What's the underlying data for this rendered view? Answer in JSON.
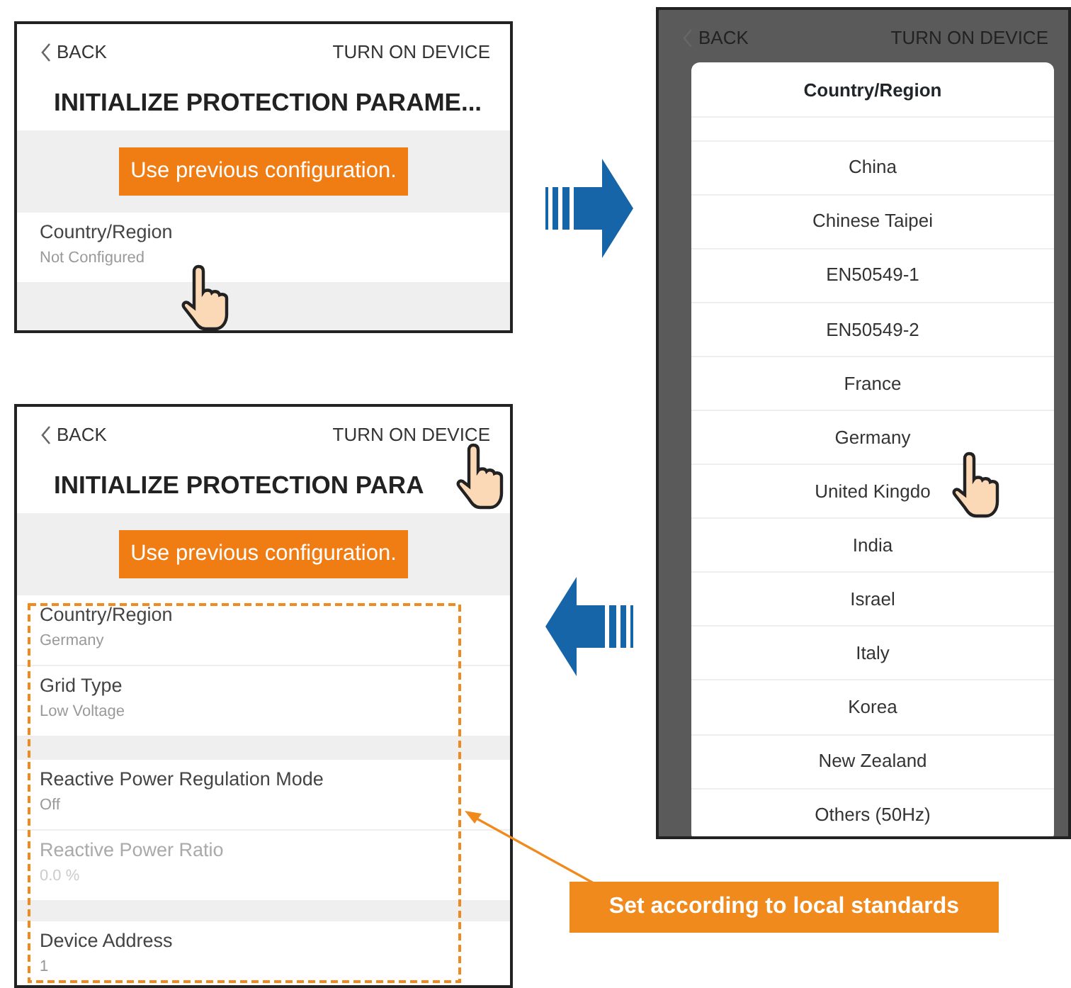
{
  "screens": [
    {
      "kind": "settings",
      "back": "BACK",
      "action": "TURN ON DEVICE",
      "title": "INITIALIZE PROTECTION PARAME...",
      "button": "Use previous configuration.",
      "groups": [
        [
          {
            "label": "Country/Region",
            "value": "Not Configured",
            "disabled": false
          }
        ]
      ]
    },
    {
      "kind": "picker",
      "back": "BACK",
      "action": "TURN ON DEVICE",
      "dialog_title": "Country/Region",
      "options": [
        "China",
        "Chinese Taipei",
        "EN50549-1",
        "EN50549-2",
        "France",
        "Germany",
        "United Kingdo",
        "India",
        "Israel",
        "Italy",
        "Korea",
        "New Zealand",
        "Others (50Hz)"
      ]
    },
    {
      "kind": "settings",
      "back": "BACK",
      "action": "TURN ON DEVICE",
      "title": "INITIALIZE PROTECTION PARA",
      "button": "Use previous configuration.",
      "groups": [
        [
          {
            "label": "Country/Region",
            "value": "Germany",
            "disabled": false
          },
          {
            "label": "Grid Type",
            "value": "Low Voltage",
            "disabled": false
          }
        ],
        [
          {
            "label": "Reactive Power Regulation Mode",
            "value": "Off",
            "disabled": false
          },
          {
            "label": "Reactive Power Ratio",
            "value": "0.0 %",
            "disabled": true
          }
        ],
        [
          {
            "label": "Device Address",
            "value": "1",
            "disabled": false
          }
        ]
      ]
    }
  ],
  "callout": {
    "text": "Set according to local standards"
  }
}
